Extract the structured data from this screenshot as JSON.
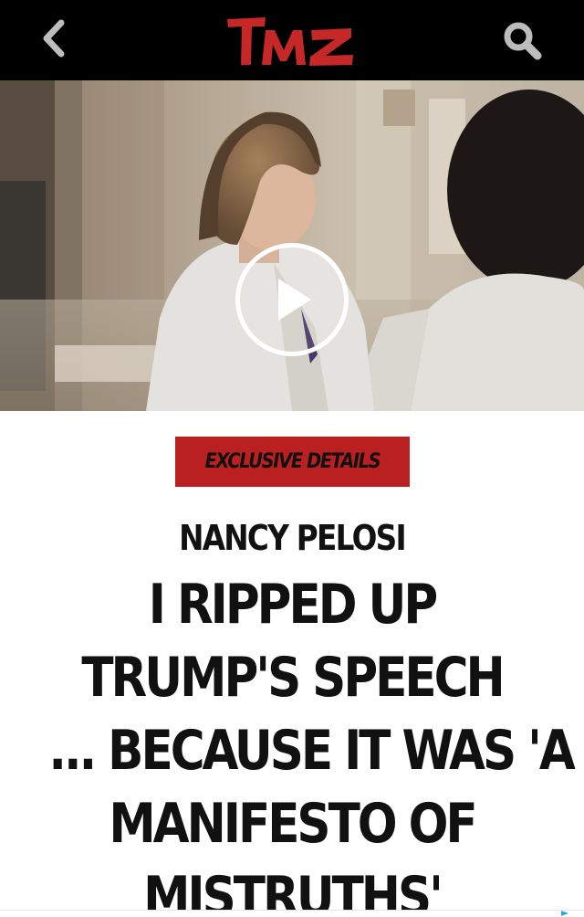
{
  "app": {
    "brand": "TMZ",
    "colors": {
      "topbar_bg": "#000000",
      "brand_red": "#c62828",
      "nav_icon": "#bdbdbd",
      "badge_bg": "#bb2020",
      "badge_text": "#111111",
      "headline_text": "#111111"
    }
  },
  "nav": {
    "back_icon": "chevron-left-icon",
    "search_icon": "search-icon"
  },
  "video": {
    "play_icon": "play-icon"
  },
  "article": {
    "badge": "EXCLUSIVE DETAILS",
    "kicker": "NANCY PELOSI",
    "headline_lines": [
      "I RIPPED UP",
      "TRUMP'S SPEECH",
      "... BECAUSE IT WAS 'A",
      "MANIFESTO OF",
      "MISTRUTHS'"
    ]
  }
}
